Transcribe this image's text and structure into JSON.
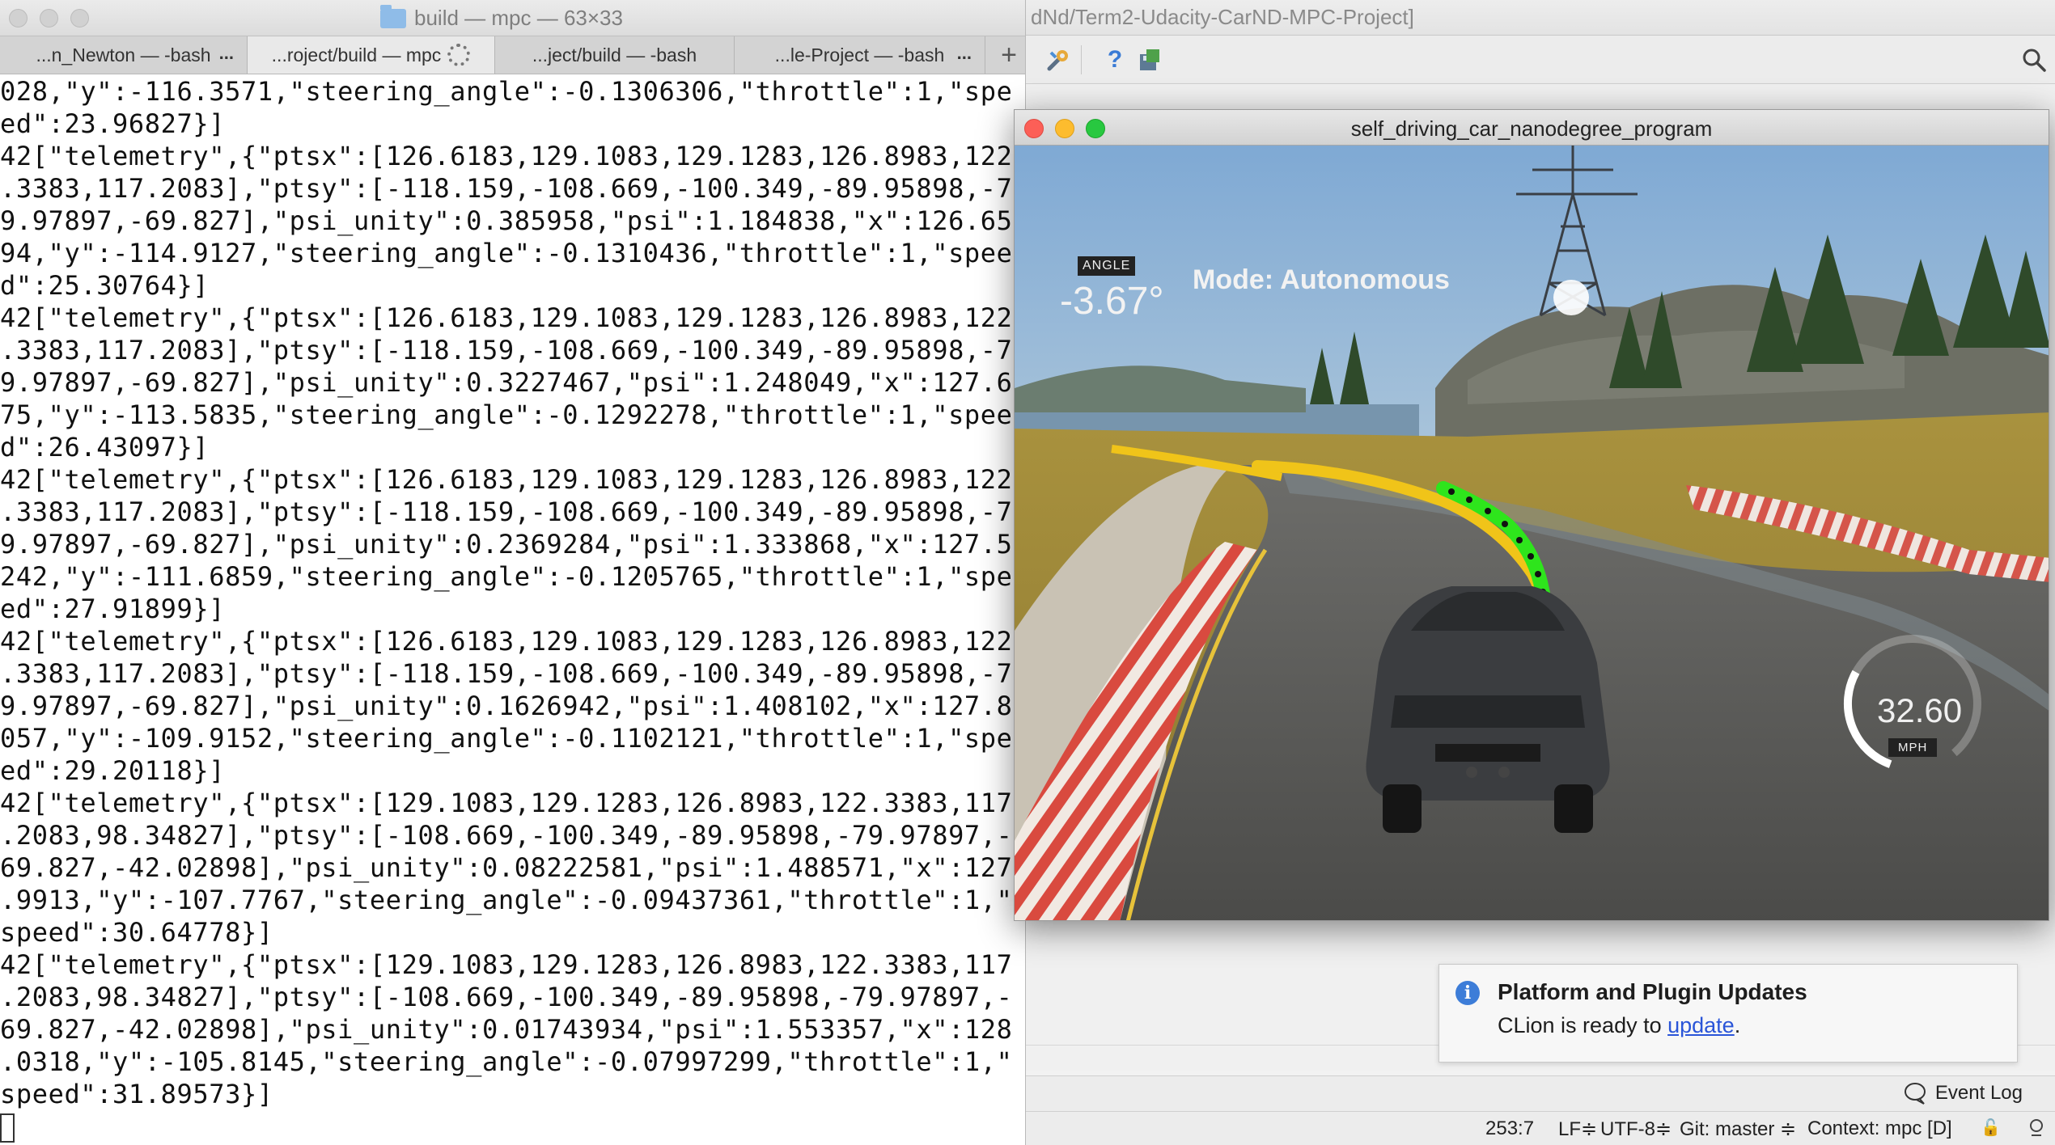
{
  "terminal": {
    "title": "build — mpc — 63×33",
    "tabs": [
      {
        "label": "...n_Newton — -bash",
        "more": "..."
      },
      {
        "label": "...roject/build — mpc",
        "more": ""
      },
      {
        "label": "...ject/build — -bash",
        "more": ""
      },
      {
        "label": "...le-Project — -bash",
        "more": "..."
      }
    ],
    "add_tab": "+",
    "lines": [
      "028,\"y\":-116.3571,\"steering_angle\":-0.1306306,\"throttle\":1,\"spe",
      "ed\":23.96827}]",
      "42[\"telemetry\",{\"ptsx\":[126.6183,129.1083,129.1283,126.8983,122",
      ".3383,117.2083],\"ptsy\":[-118.159,-108.669,-100.349,-89.95898,-7",
      "9.97897,-69.827],\"psi_unity\":0.385958,\"psi\":1.184838,\"x\":126.65",
      "94,\"y\":-114.9127,\"steering_angle\":-0.1310436,\"throttle\":1,\"spee",
      "d\":25.30764}]",
      "42[\"telemetry\",{\"ptsx\":[126.6183,129.1083,129.1283,126.8983,122",
      ".3383,117.2083],\"ptsy\":[-118.159,-108.669,-100.349,-89.95898,-7",
      "9.97897,-69.827],\"psi_unity\":0.3227467,\"psi\":1.248049,\"x\":127.6",
      "75,\"y\":-113.5835,\"steering_angle\":-0.1292278,\"throttle\":1,\"spee",
      "d\":26.43097}]",
      "42[\"telemetry\",{\"ptsx\":[126.6183,129.1083,129.1283,126.8983,122",
      ".3383,117.2083],\"ptsy\":[-118.159,-108.669,-100.349,-89.95898,-7",
      "9.97897,-69.827],\"psi_unity\":0.2369284,\"psi\":1.333868,\"x\":127.5",
      "242,\"y\":-111.6859,\"steering_angle\":-0.1205765,\"throttle\":1,\"spe",
      "ed\":27.91899}]",
      "42[\"telemetry\",{\"ptsx\":[126.6183,129.1083,129.1283,126.8983,122",
      ".3383,117.2083],\"ptsy\":[-118.159,-108.669,-100.349,-89.95898,-7",
      "9.97897,-69.827],\"psi_unity\":0.1626942,\"psi\":1.408102,\"x\":127.8",
      "057,\"y\":-109.9152,\"steering_angle\":-0.1102121,\"throttle\":1,\"spe",
      "ed\":29.20118}]",
      "42[\"telemetry\",{\"ptsx\":[129.1083,129.1283,126.8983,122.3383,117",
      ".2083,98.34827],\"ptsy\":[-108.669,-100.349,-89.95898,-79.97897,-",
      "69.827,-42.02898],\"psi_unity\":0.08222581,\"psi\":1.488571,\"x\":127",
      ".9913,\"y\":-107.7767,\"steering_angle\":-0.09437361,\"throttle\":1,\"",
      "speed\":30.64778}]",
      "42[\"telemetry\",{\"ptsx\":[129.1083,129.1283,126.8983,122.3383,117",
      ".2083,98.34827],\"ptsy\":[-108.669,-100.349,-89.95898,-79.97897,-",
      "69.827,-42.02898],\"psi_unity\":0.01743934,\"psi\":1.553357,\"x\":128",
      ".0318,\"y\":-105.8145,\"steering_angle\":-0.07997299,\"throttle\":1,\"",
      "speed\":31.89573}]"
    ]
  },
  "simulator": {
    "title": "self_driving_car_nanodegree_program",
    "angle_label": "ANGLE",
    "angle_value": "-3.67°",
    "mode": "Mode: Autonomous",
    "speed_value": "32.60",
    "speed_unit": "MPH",
    "speed_fraction": 0.33
  },
  "ide": {
    "title": "dNd/Term2-Udacity-CarND-MPC-Project]",
    "toolbar": {
      "icons": [
        "wrench-icon",
        "help-icon",
        "save-icon",
        "search-icon"
      ],
      "help_glyph": "?"
    },
    "notification": {
      "title": "Platform and Plugin Updates",
      "body_prefix": "CLion is ready to ",
      "link": "update",
      "body_suffix": "."
    },
    "event_log": "Event Log",
    "status": {
      "position": "253:7",
      "line_sep": "LF≑",
      "encoding": "UTF-8≑",
      "git": "Git: master ≑",
      "context": "Context: mpc [D]"
    }
  },
  "colors": {
    "trajectory_green": "#2ee51c",
    "reference_yellow": "#f0c419",
    "link_blue": "#2a55d8"
  }
}
